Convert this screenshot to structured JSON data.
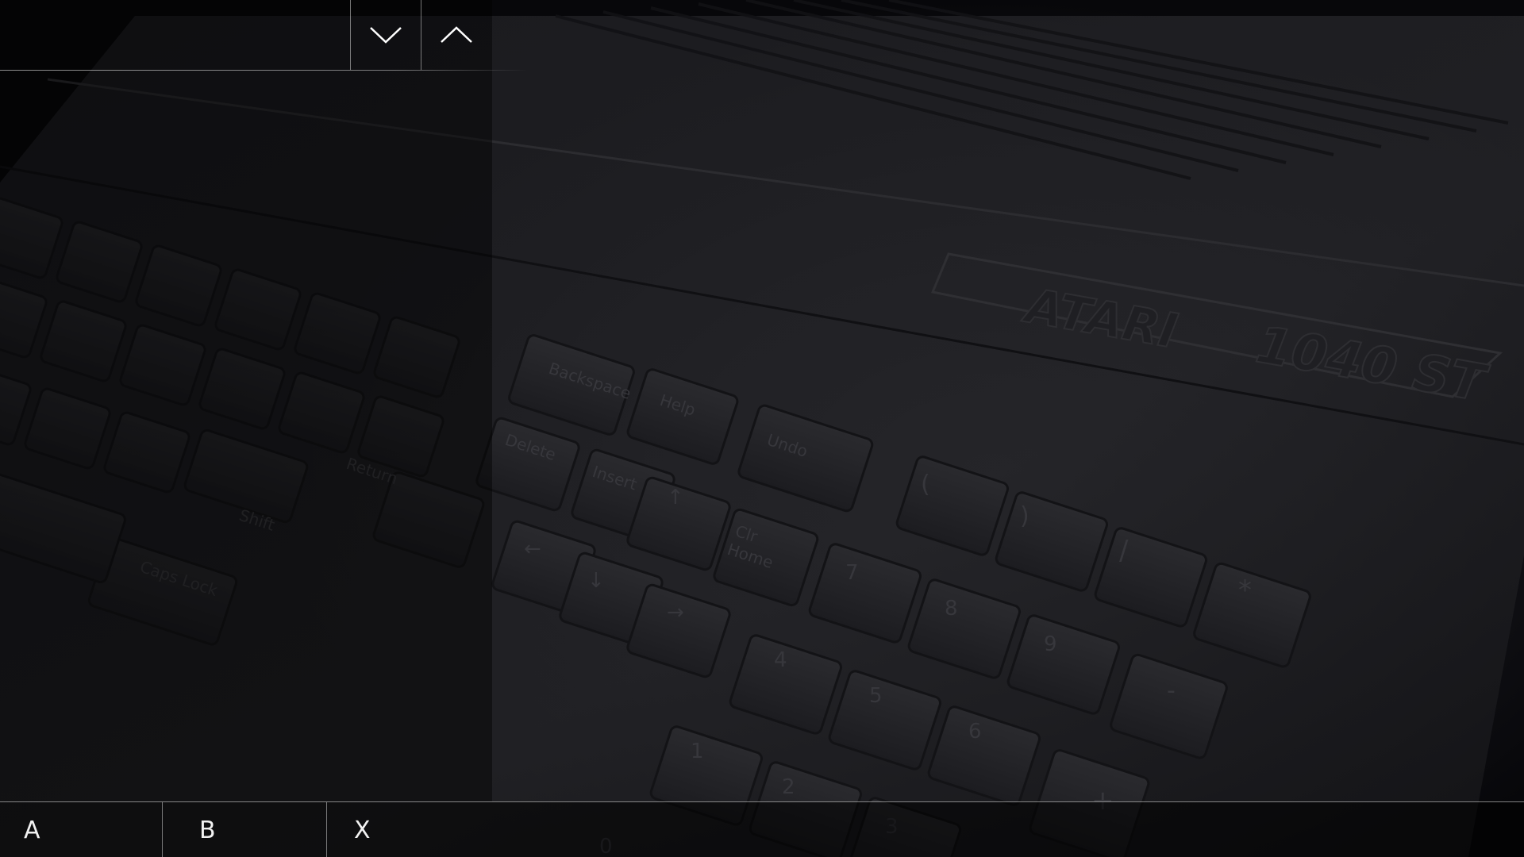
{
  "background": {
    "image": "atari-1040st-keyboard-photo",
    "key_labels": [
      "Backspace",
      "Help",
      "Undo",
      "Delete",
      "Insert",
      "Clr Home",
      "Return",
      "Caps Lock",
      "Shift",
      "(",
      ")",
      "/",
      "*",
      "7",
      "8",
      "9",
      "-",
      "4",
      "5",
      "6",
      "+",
      "1",
      "2",
      "3",
      "0",
      "↑",
      "←",
      "↓",
      "→"
    ],
    "brand_text": "ATARI",
    "model_text": "1040 ST"
  },
  "top_nav": {
    "down_icon": "chevron-down-icon",
    "up_icon": "chevron-up-icon"
  },
  "bottom_bar": {
    "buttons": [
      {
        "label": "A"
      },
      {
        "label": "B"
      },
      {
        "label": "X"
      }
    ]
  },
  "colors": {
    "foreground": "#ffffff",
    "background": "#08080c",
    "divider": "#8a8a8a"
  }
}
